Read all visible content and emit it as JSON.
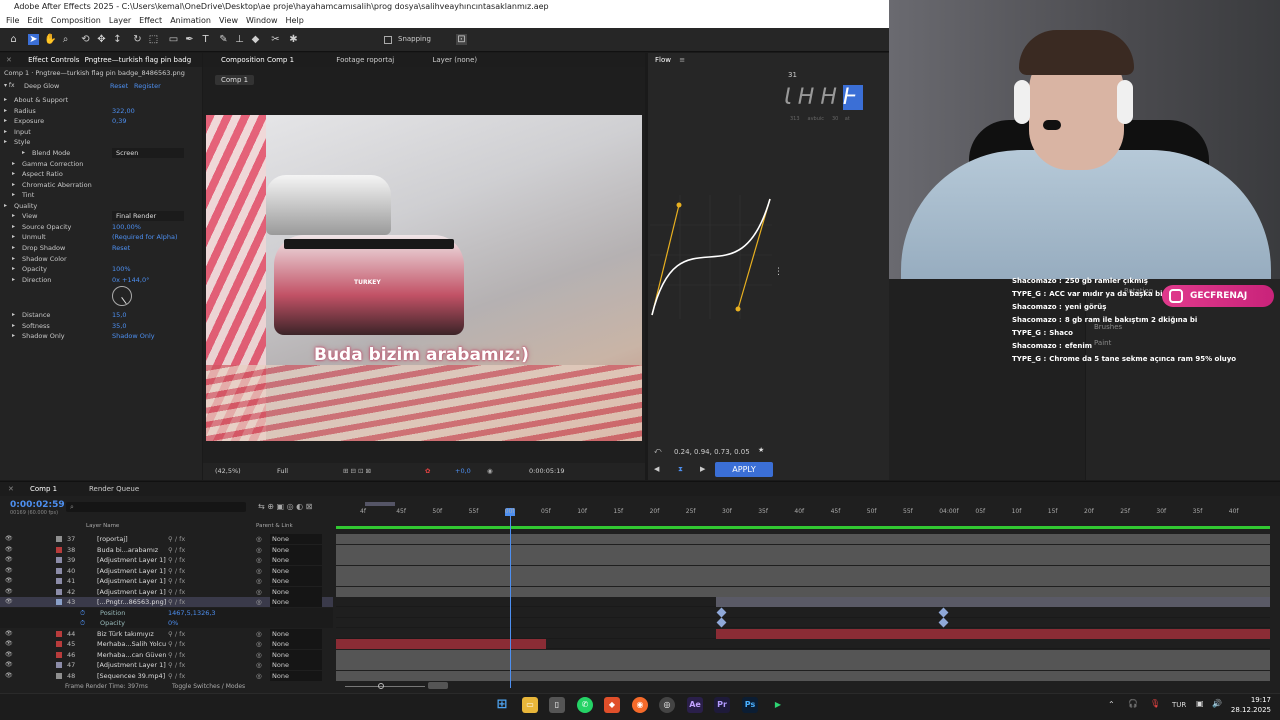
{
  "window": {
    "title": "Adobe After Effects 2025 - C:\\Users\\kemal\\OneDrive\\Desktop\\ae proje\\hayahamcamısalih\\prog dosya\\salihveayhıncıntasaklanmız.aep"
  },
  "menu": [
    "File",
    "Edit",
    "Composition",
    "Layer",
    "Effect",
    "Animation",
    "View",
    "Window",
    "Help"
  ],
  "toolbar": {
    "snapping": "Snapping"
  },
  "effect_controls": {
    "tab": "Effect Controls",
    "tab_layer": "Pngtree—turkish flag pin badg",
    "header": "Comp 1 · Pngtree—turkish flag pin badge_8486563.png",
    "effect_name": "Deep Glow",
    "reset": "Reset",
    "register": "Register",
    "props": [
      {
        "name": "About & Support",
        "value": ""
      },
      {
        "name": "Radius",
        "value": "322,00"
      },
      {
        "name": "Exposure",
        "value": "0,39"
      },
      {
        "name": "Input",
        "value": ""
      },
      {
        "name": "Style",
        "value": ""
      },
      {
        "name": "Blend Mode",
        "value": "Screen"
      },
      {
        "name": "Gamma Correction",
        "value": ""
      },
      {
        "name": "Aspect Ratio",
        "value": ""
      },
      {
        "name": "Chromatic Aberration",
        "value": ""
      },
      {
        "name": "Tint",
        "value": ""
      },
      {
        "name": "Quality",
        "value": ""
      },
      {
        "name": "View",
        "value": "Final Render"
      },
      {
        "name": "Source Opacity",
        "value": "100,00%"
      },
      {
        "name": "Unmult",
        "value": "(Required for Alpha)"
      },
      {
        "name": "Drop Shadow",
        "value": "Reset"
      },
      {
        "name": "Shadow Color",
        "value": ""
      },
      {
        "name": "Opacity",
        "value": "100%"
      },
      {
        "name": "Direction",
        "value": "0x +144,0°"
      },
      {
        "name": "Distance",
        "value": "15,0"
      },
      {
        "name": "Softness",
        "value": "35,0"
      },
      {
        "name": "Shadow Only",
        "value": "Shadow Only"
      }
    ]
  },
  "composition": {
    "tab": "Composition Comp 1",
    "footage_tab": "Footage roportaj",
    "layer_tab": "Layer (none)",
    "comp_chip": "Comp 1",
    "subtitle": "Buda bizim arabamız:)",
    "car_label": "TURKEY",
    "zoom": "(42,5%)",
    "resolution": "Full",
    "exposure": "+0,0",
    "timecode": "0:00:05:19"
  },
  "flow": {
    "tab": "Flow",
    "number": "31",
    "values": "0.24, 0.94, 0.73, 0.05",
    "apply": "APPLY",
    "preset_labels": [
      "313",
      "avbuic",
      "30",
      "at"
    ]
  },
  "chat": [
    {
      "user": "Shacomazo :",
      "msg": "250 gb ramler çıkmış"
    },
    {
      "user": "TYPE_G :",
      "msg": "ACC var mıdır ya da başka biş oyun"
    },
    {
      "user": "Shacomazo :",
      "msg": "yeni görüş"
    },
    {
      "user": "Shacomazo :",
      "msg": "8 gb ram ile bakıştım 2 dkiğına bi"
    },
    {
      "user": "TYPE_G :",
      "msg": "Shaco"
    },
    {
      "user": "Shacomazo :",
      "msg": "efenim"
    },
    {
      "user": "TYPE_G :",
      "msg": "Chrome da 5 tane sekme açınca ram 95% oluyo"
    }
  ],
  "instagram": "GECFRENAJ",
  "right_panel": {
    "rotation": "Rotation",
    "brushes": "Brushes",
    "paint": "Paint"
  },
  "timeline": {
    "tab": "Comp 1",
    "render_queue": "Render Queue",
    "current_time": "0:00:02:59",
    "fps": "00169 (60.000 fps)",
    "col_layer": "Layer Name",
    "col_parent": "Parent & Link",
    "ruler": [
      "4f",
      "45f",
      "50f",
      "55f",
      "00f",
      "05f",
      "10f",
      "15f",
      "20f",
      "25f",
      "30f",
      "35f",
      "40f",
      "45f",
      "50f",
      "55f",
      "04:00f",
      "05f",
      "10f",
      "15f",
      "20f",
      "25f",
      "30f",
      "35f",
      "40f"
    ],
    "layers": [
      {
        "num": "37",
        "name": "[roportaj]",
        "parent": "None"
      },
      {
        "num": "38",
        "name": "Buda bi...arabamız",
        "parent": "None"
      },
      {
        "num": "39",
        "name": "[Adjustment Layer 1]",
        "parent": "None"
      },
      {
        "num": "40",
        "name": "[Adjustment Layer 1]",
        "parent": "None"
      },
      {
        "num": "41",
        "name": "[Adjustment Layer 1]",
        "parent": "None"
      },
      {
        "num": "42",
        "name": "[Adjustment Layer 1]",
        "parent": "None"
      },
      {
        "num": "43",
        "name": "[...Pngtr...86563.png]",
        "parent": "None"
      },
      {
        "num": "",
        "name": "Position",
        "parent": "",
        "value": "1467,5,1326,3"
      },
      {
        "num": "",
        "name": "Opacity",
        "parent": "",
        "value": "0%"
      },
      {
        "num": "44",
        "name": "Biz Türk takımıyız",
        "parent": "None"
      },
      {
        "num": "45",
        "name": "Merhaba...Salih Yolcu",
        "parent": "None"
      },
      {
        "num": "46",
        "name": "Merhaba...can Güven",
        "parent": "None"
      },
      {
        "num": "47",
        "name": "[Adjustment Layer 1]",
        "parent": "None"
      },
      {
        "num": "48",
        "name": "[Sequencee 39.mp4]",
        "parent": "None"
      }
    ],
    "frame_render": "Frame Render Time: 397ms",
    "toggle": "Toggle Switches / Modes"
  },
  "taskbar": {
    "lang": "TUR",
    "time": "19:17",
    "date": "28.12.2025",
    "icons": [
      "windows-icon",
      "files-icon",
      "phone-icon",
      "whatsapp-icon",
      "brave-icon",
      "firefox-icon",
      "chrome-icon",
      "after-effects-icon",
      "premiere-icon",
      "photoshop-icon",
      "media-icon"
    ],
    "ae": "Ae",
    "pr": "Pr",
    "ps": "Ps"
  }
}
